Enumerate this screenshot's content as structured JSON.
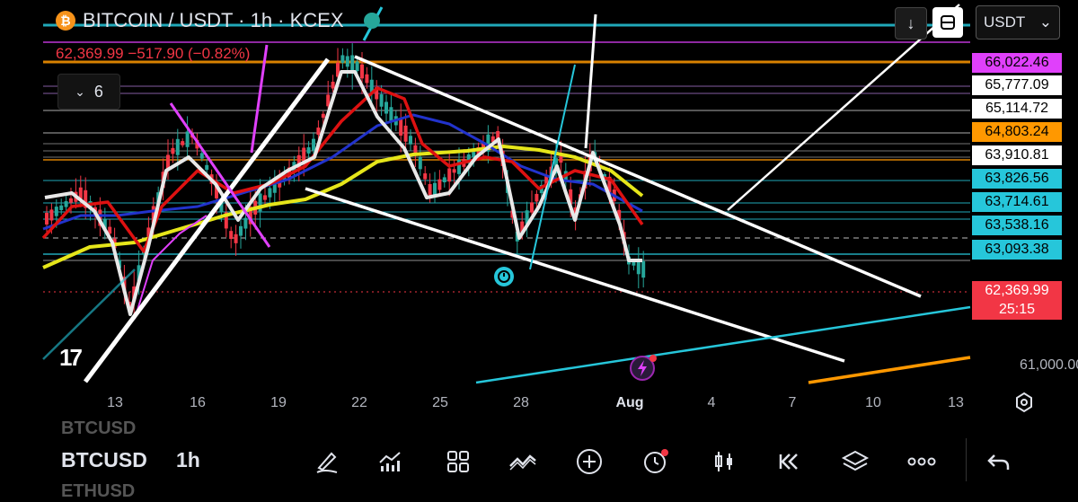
{
  "header": {
    "coin_symbol": "₿",
    "title": "BITCOIN / USDT · 1h · KCEX",
    "price_change": "62,369.99  −517.90 (−0.82%)",
    "indicators_count": "6"
  },
  "top_right": {
    "currency": "USDT",
    "currency_arrow": "⌄"
  },
  "price_labels": [
    {
      "text": "66,022.46",
      "bg": "#e040fb",
      "fg": "#000000"
    },
    {
      "text": "65,777.09",
      "bg": "#ffffff",
      "fg": "#000000"
    },
    {
      "text": "65,114.72",
      "bg": "#ffffff",
      "fg": "#000000"
    },
    {
      "text": "64,803.24",
      "bg": "#ff9800",
      "fg": "#000000"
    },
    {
      "text": "63,910.81",
      "bg": "#ffffff",
      "fg": "#000000"
    },
    {
      "text": "63,826.56",
      "bg": "#26c6da",
      "fg": "#000000"
    },
    {
      "text": "63,714.61",
      "bg": "#26c6da",
      "fg": "#000000"
    },
    {
      "text": "63,538.16",
      "bg": "#26c6da",
      "fg": "#000000"
    },
    {
      "text": "63,093.38",
      "bg": "#26c6da",
      "fg": "#000000"
    },
    {
      "text": "62,369.99",
      "bg": "#f23645",
      "fg": "#ffffff"
    },
    {
      "text": "25:15",
      "bg": "#f23645",
      "fg": "#ffffff"
    }
  ],
  "price_axis_plain": "61,000.00",
  "date_axis": [
    "13",
    "16",
    "19",
    "22",
    "25",
    "28",
    "Aug",
    "4",
    "7",
    "10",
    "13"
  ],
  "logo_text": "17",
  "bottom": {
    "symbol_prev": "BTCUSD",
    "symbol": "BTCUSD",
    "symbol_next": "ETHUSD",
    "timeframe": "1h"
  },
  "toolbar_icons": [
    "pencil-icon",
    "indicators-icon",
    "templates-icon",
    "trend-icon",
    "add-icon",
    "alert-icon",
    "candles-icon",
    "replay-icon",
    "layers-icon",
    "more-icon",
    "undo-icon"
  ],
  "colors": {
    "up": "#26a69a",
    "down": "#f23645",
    "accent_cyan": "#26c6da",
    "magenta": "#e040fb",
    "orange": "#ff9800",
    "yellow": "#e6e61a"
  }
}
